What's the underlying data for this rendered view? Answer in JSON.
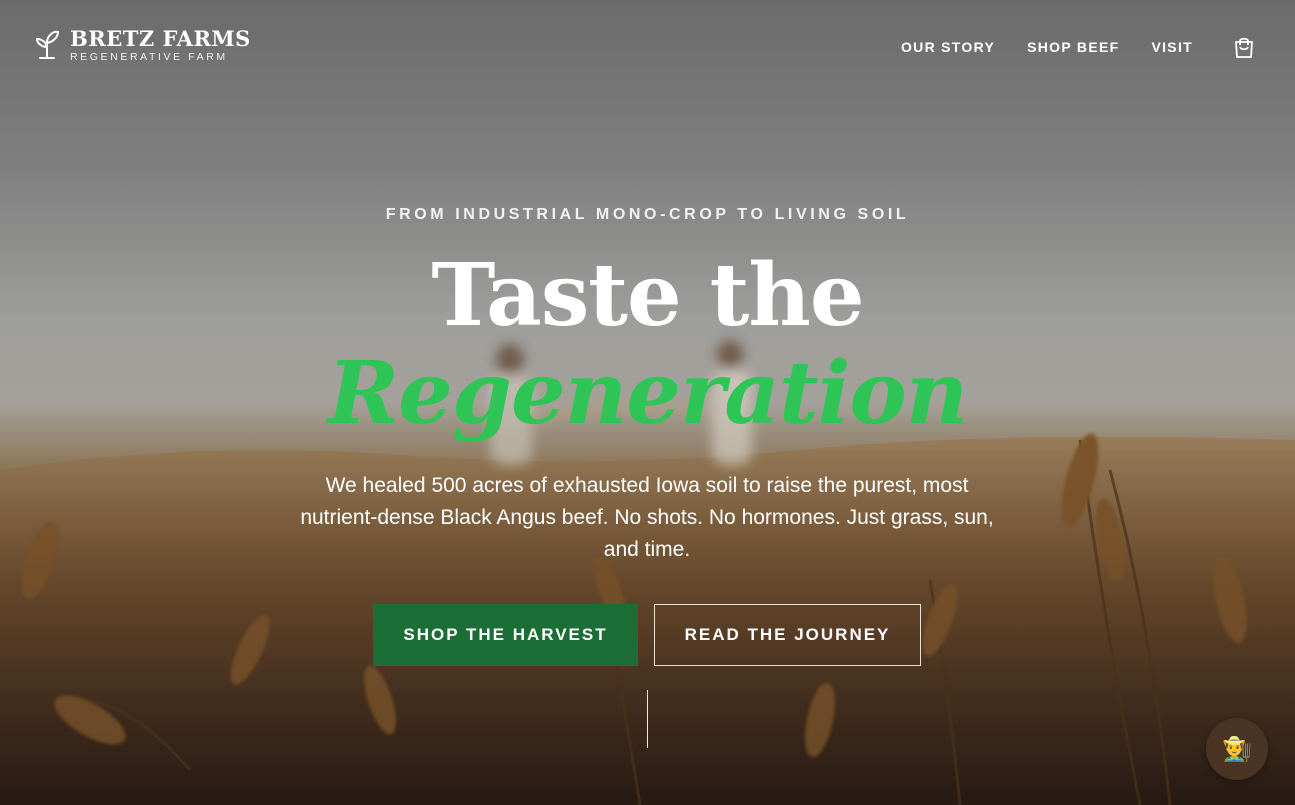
{
  "brand": {
    "name": "BRETZ FARMS",
    "tagline": "REGENERATIVE FARM"
  },
  "nav": {
    "items": [
      "OUR STORY",
      "SHOP BEEF",
      "VISIT"
    ],
    "cart_icon": "shopping-bag-icon"
  },
  "hero": {
    "eyebrow": "FROM INDUSTRIAL MONO-CROP TO LIVING SOIL",
    "headline": "Taste the",
    "headline_accent": "Regeneration",
    "lede": "We healed 500 acres of exhausted Iowa soil to raise the purest, most nutrient-dense Black Angus beef. No shots. No hormones. Just grass, sun, and time.",
    "primary_cta": "SHOP THE HARVEST",
    "secondary_cta": "READ THE JOURNEY"
  },
  "chat": {
    "icon": "farmer-avatar-icon",
    "glyph": "👨‍🌾"
  },
  "colors": {
    "accent_green": "#2fc456",
    "button_green": "#1b6e36"
  }
}
